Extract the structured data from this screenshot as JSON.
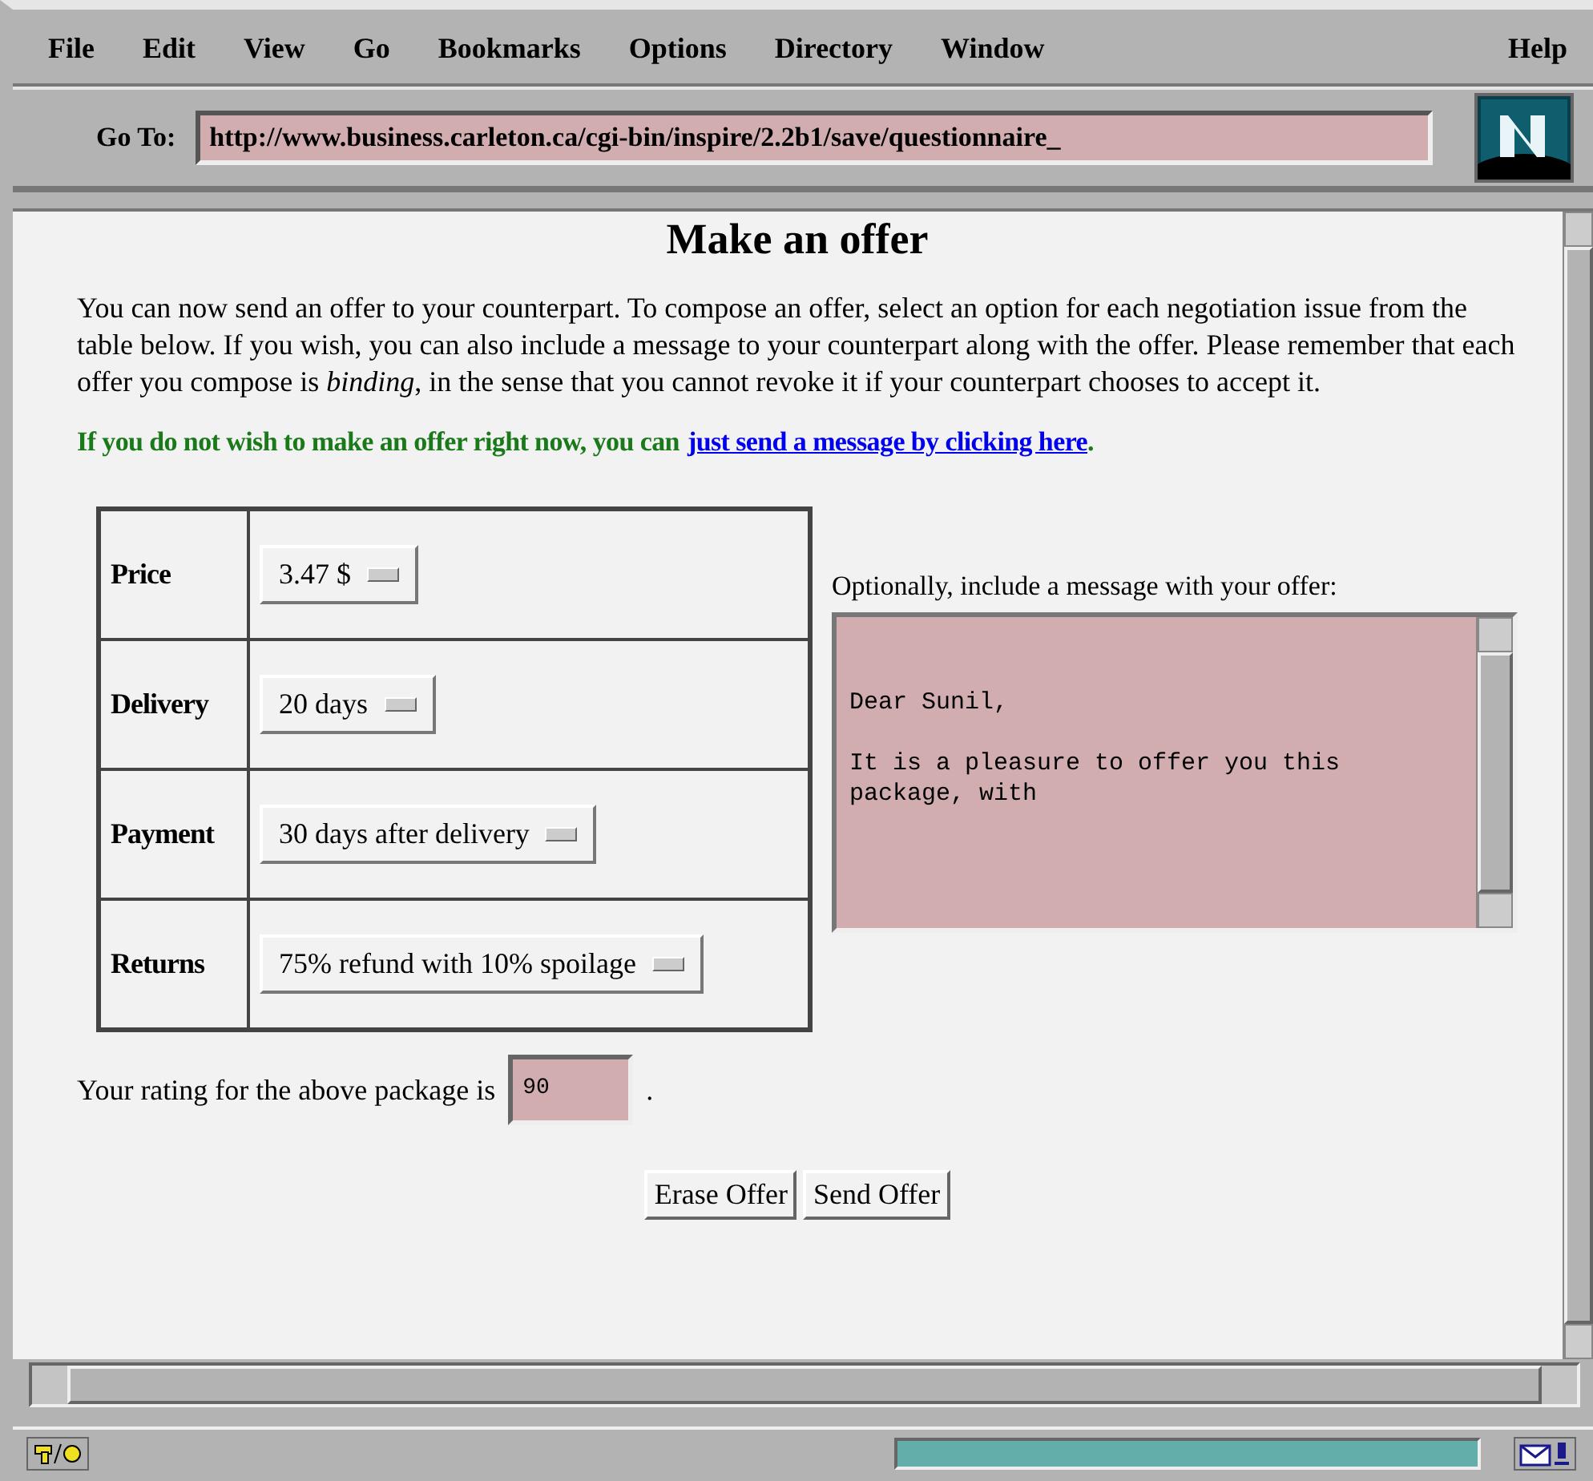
{
  "menu": {
    "items": [
      "File",
      "Edit",
      "View",
      "Go",
      "Bookmarks",
      "Options",
      "Directory",
      "Window"
    ],
    "help": "Help"
  },
  "location": {
    "label": "Go To:",
    "value": "http://www.business.carleton.ca/cgi-bin/inspire/2.2b1/save/questionnaire_"
  },
  "page": {
    "title": "Make an offer",
    "intro": "You can now send an offer to your counterpart. To compose an offer, select an option for each negotiation issue from the table below. If you wish, you can also include a message to your counterpart along with the offer. Please remember that each offer you compose is *binding*, in the sense that you cannot revoke it if your counterpart chooses to accept it.",
    "notice": "If you do not wish to make an offer right now, you can",
    "notice_link": "just send a message by clicking here",
    "notice_end": ".",
    "issues": [
      {
        "label": "Price",
        "value": "3.47 $"
      },
      {
        "label": "Delivery",
        "value": "20 days"
      },
      {
        "label": "Payment",
        "value": "30 days after delivery"
      },
      {
        "label": "Returns",
        "value": "75% refund with 10% spoilage"
      }
    ],
    "message_label": "Optionally, include a message with your offer:",
    "message_paragraphs": [
      "Dear Sunil,",
      "It is a pleasure to offer you this package, with"
    ],
    "rating_label": "Your rating for the above package is",
    "rating_value": "90",
    "rating_end": ".",
    "buttons": [
      "Erase Offer",
      "Send Offer"
    ]
  },
  "status_bar": {
    "progress": {
      "level": 1
    }
  }
}
